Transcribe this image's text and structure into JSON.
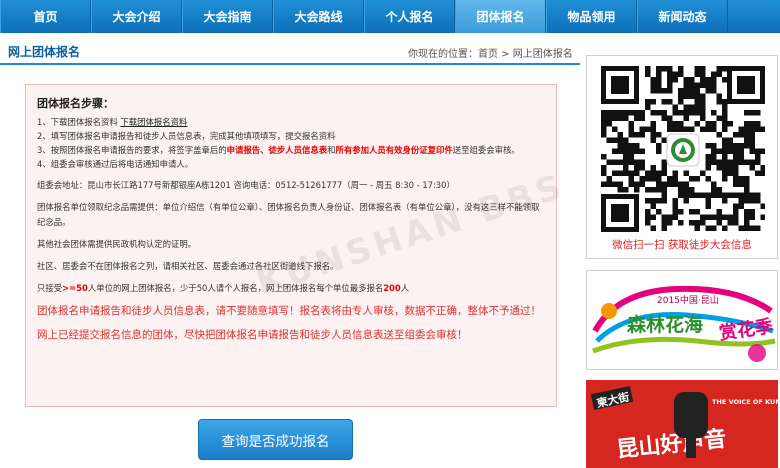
{
  "nav": {
    "items": [
      "首页",
      "大会介绍",
      "大会指南",
      "大会路线",
      "个人报名",
      "团体报名",
      "物品领用",
      "新闻动态"
    ],
    "active_index": 5
  },
  "header": {
    "section_title": "网上团体报名",
    "breadcrumb": "你现在的位置：首页 > 网上团体报名"
  },
  "steps": {
    "title": "团体报名步骤：",
    "s1_prefix": "1、下载团体报名资料 ",
    "s1_link": "下载团体报名资料",
    "s2": "2、填写团体报名申请报告和徒步人员信息表，完成其他填项填写，提交报名资料",
    "s3_a": "3、按照团体报名申请报告的要求，将签字盖章后的",
    "s3_red1": "申请报告、徒步人员信息表",
    "s3_b": "和",
    "s3_red2": "所有参加人员有效身份证复印件",
    "s3_c": "送至组委会审核。",
    "s4": "4、组委会审核通过后将电话通知申请人。",
    "address": "组委会地址：昆山市长江路177号新都银座A栋1201  咨询电话：0512-51261777（周一 - 周五 8:30 - 17:30）",
    "note1": "团体报名单位领取纪念品需提供：单位介绍信（有单位公章）、团体报名负责人身份证、团体报名表（有单位公章），没有这三样不能领取纪念品。",
    "note2": "其他社会团体需提供民政机构认定的证明。",
    "note3": "社区、居委会不在团体报名之列，请相关社区、居委会通过各社区街道线下报名。",
    "note4_a": "只接受",
    "note4_red1": ">=50",
    "note4_b": "人单位的网上团体报名，少于50人请个人报名，网上团体报名每个单位最多报名",
    "note4_red2": "200",
    "note4_c": "人",
    "warn1": "团体报名申请报告和徒步人员信息表，请不要随意填写！报名表将由专人审核，数据不正确，整体不予通过！",
    "warn2": "网上已经提交报名信息的团体，尽快把团体报名申请报告和徒步人员信息表送至组委会审核！"
  },
  "watermark": "KUNSHAN BBS",
  "query_button": "查询是否成功报名",
  "sidebar": {
    "qr_caption": "微信扫一扫  获取徒步大会信息",
    "ad1_text_a": "2015中国·昆山",
    "ad1_text_b": "森林花海",
    "ad1_text_c": "赏花季",
    "ad2_text_a": "柬大街",
    "ad2_text_b": "昆山好声音",
    "ad2_text_c": "THE VOICE OF KUNSHAN"
  },
  "colors": {
    "nav": "#1a82cc",
    "accent_red": "#e60000",
    "box_bg": "#fdf2f2",
    "box_border": "#f3b7b7"
  }
}
